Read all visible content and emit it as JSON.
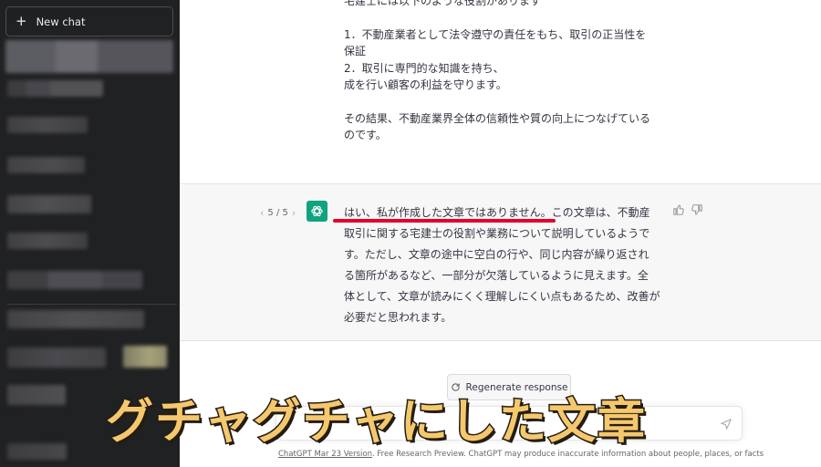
{
  "sidebar": {
    "new_chat_label": "New chat"
  },
  "conversation": {
    "previous_message_lines": [
      "宅建士には以下のような役割があります",
      "1．不動産業者として法令遵守の責任をもち、取引の正当性を",
      "保証",
      "2．取引に専門的な知識を持ち、",
      "成を行い顧客の利益を守ります。",
      "その結果、不動産業界全体の信頼性や質の向上につなげている",
      "のです。"
    ],
    "pager": "5 / 5",
    "reply_lines": [
      "はい、私が作成した文章ではありません。この文章は、不動産",
      "取引に関する宅建士の役割や業務について説明しているようで",
      "す。ただし、文章の途中に空白の行や、同じ内容が繰り返され",
      "る箇所があるなど、一部分が欠落しているように見えます。全",
      "体として、文章が読みにくく理解しにくい点もあるため、改善が",
      "必要だと思われます。"
    ]
  },
  "regenerate_label": "Regenerate response",
  "footer": {
    "version_link": "ChatGPT Mar 23 Version",
    "text": ". Free Research Preview. ChatGPT may produce inaccurate information about people, places, or facts"
  },
  "caption": "グチャグチャにした文章",
  "colors": {
    "sidebar_bg": "#202123",
    "accent_green": "#10a37f",
    "underline_red": "#e4002b",
    "caption_fill": "#f6c86d"
  },
  "icons": [
    "plus-icon",
    "chevron-left-icon",
    "chevron-right-icon",
    "openai-logo-icon",
    "thumbs-up-icon",
    "thumbs-down-icon",
    "refresh-icon",
    "send-icon"
  ]
}
